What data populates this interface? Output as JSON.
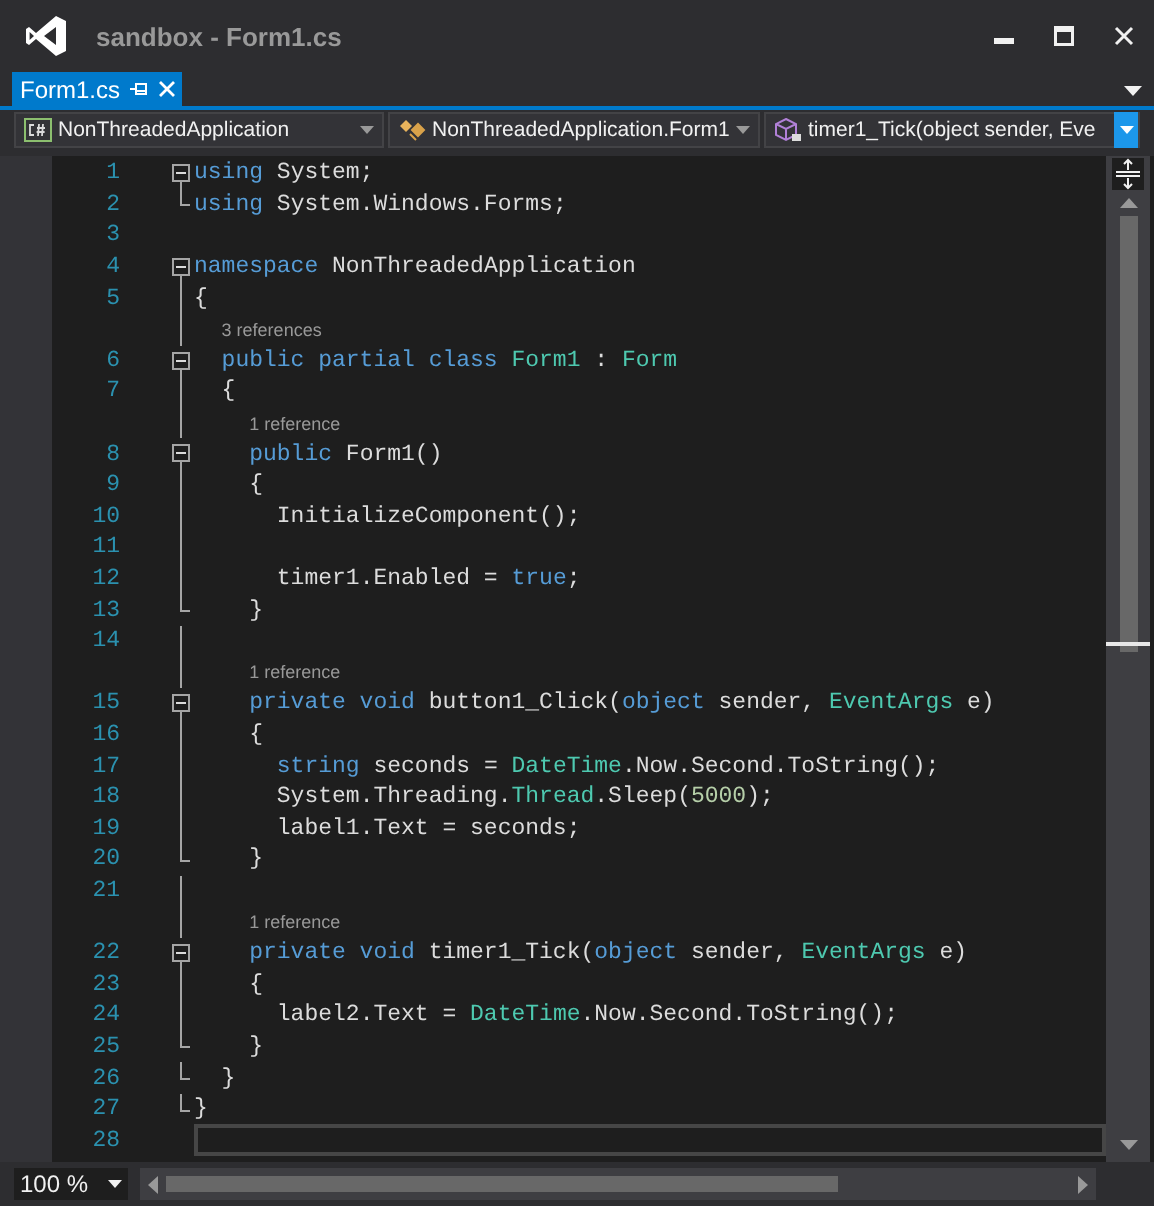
{
  "window": {
    "title": "sandbox - Form1.cs"
  },
  "tabs": [
    {
      "label": "Form1.cs",
      "selected": true
    }
  ],
  "navigation_bar": [
    {
      "kind": "project",
      "value": "NonThreadedApplication",
      "active": false
    },
    {
      "kind": "class",
      "value": "NonThreadedApplication.Form1",
      "active": false
    },
    {
      "kind": "member",
      "value": "timer1_Tick(object sender, Eve",
      "active": true
    }
  ],
  "editor": {
    "lines": [
      {
        "kind": "code",
        "number": "1",
        "collapsible": true,
        "guide": false,
        "block_end": false,
        "tokens": [
          {
            "kind": "kw",
            "text": "using"
          },
          {
            "kind": "plain",
            "text": " System;"
          }
        ]
      },
      {
        "kind": "code",
        "number": "2",
        "collapsible": false,
        "guide": false,
        "block_end": true,
        "tokens": [
          {
            "kind": "kw",
            "text": "using"
          },
          {
            "kind": "plain",
            "text": " System.Windows.Forms;"
          }
        ]
      },
      {
        "kind": "code",
        "number": "3",
        "collapsible": false,
        "guide": false,
        "block_end": false
      },
      {
        "kind": "code",
        "number": "4",
        "collapsible": true,
        "guide": false,
        "block_end": false,
        "tokens": [
          {
            "kind": "kw",
            "text": "namespace"
          },
          {
            "kind": "plain",
            "text": " NonThreadedApplication"
          }
        ]
      },
      {
        "kind": "code",
        "number": "5",
        "collapsible": false,
        "guide": true,
        "block_end": false,
        "tokens": [
          {
            "kind": "plain",
            "text": "{"
          }
        ]
      },
      {
        "kind": "lens",
        "text": "3 references",
        "collapsible": false,
        "guide": true,
        "block_end": false
      },
      {
        "kind": "code",
        "number": "6",
        "collapsible": true,
        "guide": false,
        "block_end": false,
        "tokens": [
          {
            "kind": "kw",
            "text": "  public partial class"
          },
          {
            "kind": "type",
            "text": " Form1"
          },
          {
            "kind": "plain",
            "text": " : "
          },
          {
            "kind": "type",
            "text": "Form"
          }
        ]
      },
      {
        "kind": "code",
        "number": "7",
        "collapsible": false,
        "guide": true,
        "block_end": false,
        "tokens": [
          {
            "kind": "plain",
            "text": "  {"
          }
        ]
      },
      {
        "kind": "lens",
        "text": "1 reference",
        "collapsible": false,
        "guide": true,
        "block_end": false
      },
      {
        "kind": "code",
        "number": "8",
        "collapsible": true,
        "guide": false,
        "block_end": false,
        "tokens": [
          {
            "kind": "kw",
            "text": "    public"
          },
          {
            "kind": "plain",
            "text": " Form1()"
          }
        ]
      },
      {
        "kind": "code",
        "number": "9",
        "collapsible": false,
        "guide": true,
        "block_end": false,
        "tokens": [
          {
            "kind": "plain",
            "text": "    {"
          }
        ]
      },
      {
        "kind": "code",
        "number": "10",
        "collapsible": false,
        "guide": true,
        "block_end": false,
        "tokens": [
          {
            "kind": "plain",
            "text": "      InitializeComponent();"
          }
        ]
      },
      {
        "kind": "code",
        "number": "11",
        "collapsible": false,
        "guide": true,
        "block_end": false
      },
      {
        "kind": "code",
        "number": "12",
        "collapsible": false,
        "guide": true,
        "block_end": false,
        "tokens": [
          {
            "kind": "plain",
            "text": "      timer1.Enabled = "
          },
          {
            "kind": "kw",
            "text": "true"
          },
          {
            "kind": "plain",
            "text": ";"
          }
        ]
      },
      {
        "kind": "code",
        "number": "13",
        "collapsible": false,
        "guide": false,
        "block_end": true,
        "tokens": [
          {
            "kind": "plain",
            "text": "    }"
          }
        ]
      },
      {
        "kind": "code",
        "number": "14",
        "collapsible": false,
        "guide": true,
        "block_end": false
      },
      {
        "kind": "lens",
        "text": "1 reference",
        "collapsible": false,
        "guide": true,
        "block_end": false
      },
      {
        "kind": "code",
        "number": "15",
        "collapsible": true,
        "guide": false,
        "block_end": false,
        "tokens": [
          {
            "kind": "kw",
            "text": "    private void"
          },
          {
            "kind": "plain",
            "text": " button1_Click("
          },
          {
            "kind": "kw",
            "text": "object"
          },
          {
            "kind": "plain",
            "text": " sender, "
          },
          {
            "kind": "type",
            "text": "EventArgs"
          },
          {
            "kind": "plain",
            "text": " e)"
          }
        ]
      },
      {
        "kind": "code",
        "number": "16",
        "collapsible": false,
        "guide": true,
        "block_end": false,
        "tokens": [
          {
            "kind": "plain",
            "text": "    {"
          }
        ]
      },
      {
        "kind": "code",
        "number": "17",
        "collapsible": false,
        "guide": true,
        "block_end": false,
        "tokens": [
          {
            "kind": "kw",
            "text": "      string"
          },
          {
            "kind": "plain",
            "text": " seconds = "
          },
          {
            "kind": "type",
            "text": "DateTime"
          },
          {
            "kind": "plain",
            "text": ".Now.Second.ToString();"
          }
        ]
      },
      {
        "kind": "code",
        "number": "18",
        "collapsible": false,
        "guide": true,
        "block_end": false,
        "tokens": [
          {
            "kind": "plain",
            "text": "      System.Threading."
          },
          {
            "kind": "type",
            "text": "Thread"
          },
          {
            "kind": "plain",
            "text": ".Sleep("
          },
          {
            "kind": "num",
            "text": "5000"
          },
          {
            "kind": "plain",
            "text": ");"
          }
        ]
      },
      {
        "kind": "code",
        "number": "19",
        "collapsible": false,
        "guide": true,
        "block_end": false,
        "tokens": [
          {
            "kind": "plain",
            "text": "      label1.Text = seconds;"
          }
        ]
      },
      {
        "kind": "code",
        "number": "20",
        "collapsible": false,
        "guide": false,
        "block_end": true,
        "tokens": [
          {
            "kind": "plain",
            "text": "    }"
          }
        ]
      },
      {
        "kind": "code",
        "number": "21",
        "collapsible": false,
        "guide": true,
        "block_end": false
      },
      {
        "kind": "lens",
        "text": "1 reference",
        "collapsible": false,
        "guide": true,
        "block_end": false
      },
      {
        "kind": "code",
        "number": "22",
        "collapsible": true,
        "guide": false,
        "block_end": false,
        "tokens": [
          {
            "kind": "kw",
            "text": "    private void"
          },
          {
            "kind": "plain",
            "text": " timer1_Tick("
          },
          {
            "kind": "kw",
            "text": "object"
          },
          {
            "kind": "plain",
            "text": " sender, "
          },
          {
            "kind": "type",
            "text": "EventArgs"
          },
          {
            "kind": "plain",
            "text": " e)"
          }
        ]
      },
      {
        "kind": "code",
        "number": "23",
        "collapsible": false,
        "guide": true,
        "block_end": false,
        "tokens": [
          {
            "kind": "plain",
            "text": "    {"
          }
        ]
      },
      {
        "kind": "code",
        "number": "24",
        "collapsible": false,
        "guide": true,
        "block_end": false,
        "tokens": [
          {
            "kind": "plain",
            "text": "      label2.Text = "
          },
          {
            "kind": "type",
            "text": "DateTime"
          },
          {
            "kind": "plain",
            "text": ".Now.Second.ToString();"
          }
        ]
      },
      {
        "kind": "code",
        "number": "25",
        "collapsible": false,
        "guide": false,
        "block_end": true,
        "tokens": [
          {
            "kind": "plain",
            "text": "    }"
          }
        ]
      },
      {
        "kind": "code",
        "number": "26",
        "collapsible": false,
        "guide": false,
        "block_end": true,
        "tokens": [
          {
            "kind": "plain",
            "text": "  }"
          }
        ]
      },
      {
        "kind": "code",
        "number": "27",
        "collapsible": false,
        "guide": false,
        "block_end": true,
        "tokens": [
          {
            "kind": "plain",
            "text": "}"
          }
        ]
      },
      {
        "kind": "code",
        "number": "28",
        "collapsible": false,
        "guide": false,
        "block_end": false,
        "current": true
      }
    ]
  },
  "zoom": {
    "value": "100 %"
  }
}
